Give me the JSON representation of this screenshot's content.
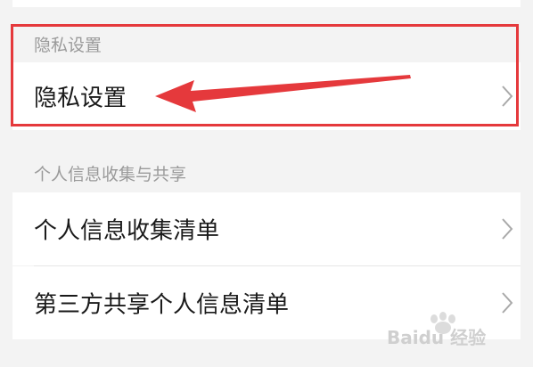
{
  "sections": {
    "privacy": {
      "header": "隐私设置",
      "items": [
        {
          "label": "隐私设置"
        }
      ]
    },
    "personal_info": {
      "header": "个人信息收集与共享",
      "items": [
        {
          "label": "个人信息收集清单"
        },
        {
          "label": "第三方共享个人信息清单"
        }
      ]
    }
  },
  "annotation": {
    "highlight_color": "#e5393c"
  },
  "watermark": {
    "text": "Baidu 经验"
  },
  "icons": {
    "row_chevron": "chevron-right-icon"
  }
}
